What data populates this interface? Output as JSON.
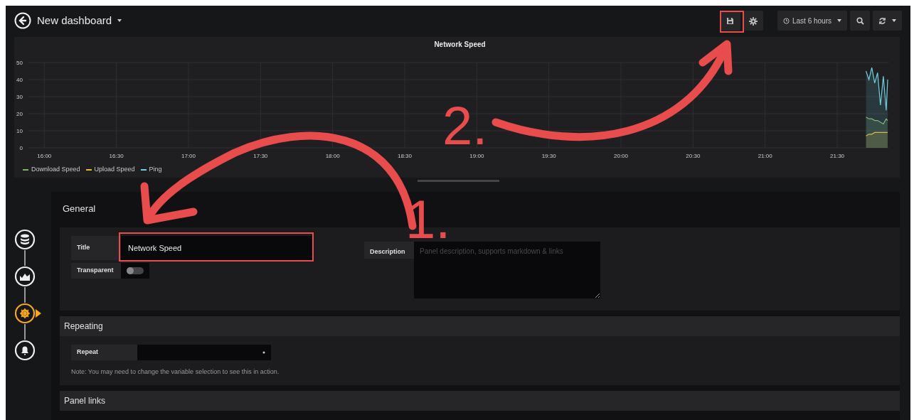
{
  "header": {
    "title": "New dashboard",
    "time_range": "Last 6 hours"
  },
  "panel": {
    "chart_data": {
      "type": "area",
      "grid": true,
      "title": "Network Speed",
      "xlim": [
        15.89,
        21.86
      ],
      "ylim": [
        0,
        50
      ],
      "yticks": [
        0,
        10,
        20,
        30,
        40,
        50
      ],
      "xticks": [
        {
          "value": 16,
          "label": "16:00"
        },
        {
          "value": 16.5,
          "label": "16:30"
        },
        {
          "value": 17,
          "label": "17:00"
        },
        {
          "value": 17.5,
          "label": "17:30"
        },
        {
          "value": 18,
          "label": "18:00"
        },
        {
          "value": 18.5,
          "label": "18:30"
        },
        {
          "value": 19,
          "label": "19:00"
        },
        {
          "value": 19.5,
          "label": "19:30"
        },
        {
          "value": 20,
          "label": "20:00"
        },
        {
          "value": 20.5,
          "label": "20:30"
        },
        {
          "value": 21,
          "label": "21:00"
        },
        {
          "value": 21.5,
          "label": "21:30"
        }
      ],
      "x": [
        21.7,
        21.72,
        21.74,
        21.76,
        21.78,
        21.8,
        21.82,
        21.84,
        21.85
      ],
      "series": [
        {
          "name": "Download Speed",
          "color": "#7eb26d",
          "values": [
            18,
            17,
            17,
            16,
            16,
            15,
            14,
            17,
            16
          ]
        },
        {
          "name": "Upload Speed",
          "color": "#eab839",
          "values": [
            7,
            8,
            8,
            9,
            9,
            9,
            9,
            9,
            9
          ]
        },
        {
          "name": "Ping",
          "color": "#6ed0e0",
          "values": [
            45,
            40,
            47,
            38,
            44,
            25,
            42,
            22,
            40
          ]
        }
      ]
    }
  },
  "editor": {
    "rail": [
      {
        "kind": "queries",
        "selected": false
      },
      {
        "kind": "visualization",
        "selected": false
      },
      {
        "kind": "general",
        "selected": true
      },
      {
        "kind": "alert",
        "selected": false
      }
    ],
    "general": {
      "heading": "General",
      "title_label": "Title",
      "title_value": "Network Speed",
      "transparent_label": "Transparent",
      "transparent_on": false,
      "description_label": "Description",
      "description_placeholder": "Panel description, supports markdown & links"
    },
    "repeating": {
      "heading": "Repeating",
      "repeat_label": "Repeat",
      "note": "Note: You may need to change the variable selection to see this in action."
    },
    "panel_links": {
      "heading": "Panel links"
    }
  },
  "annotations": [
    {
      "kind": "save",
      "label": "2."
    },
    {
      "kind": "title",
      "label": "1."
    }
  ]
}
